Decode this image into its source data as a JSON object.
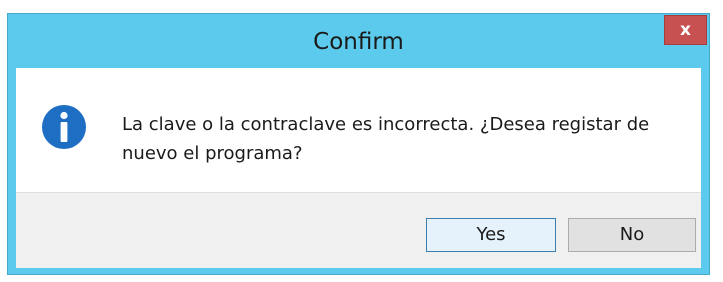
{
  "window": {
    "title": "Confirm",
    "close_glyph": "x",
    "titlebar_color": "#5ccaec",
    "close_color": "#c75050"
  },
  "dialog": {
    "icon": "info-icon",
    "icon_color": "#1e6fc4",
    "message": "La clave o la contraclave es incorrecta. ¿Desea registar de nuevo el programa?"
  },
  "buttons": {
    "yes_label": "Yes",
    "no_label": "No"
  }
}
